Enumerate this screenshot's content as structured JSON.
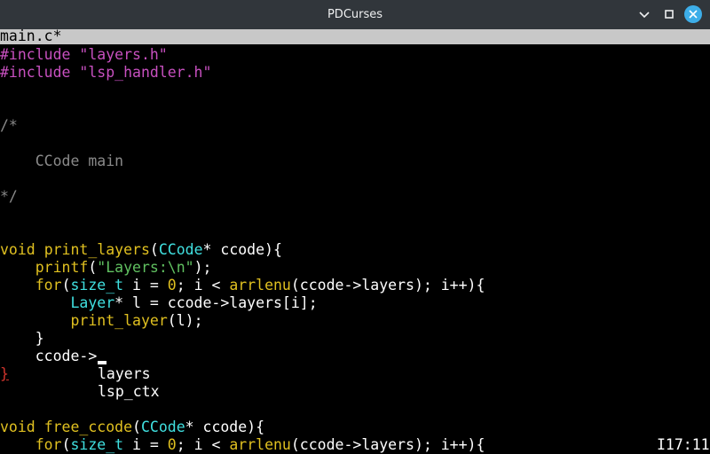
{
  "window": {
    "title": "PDCurses",
    "titlebar_color": "#31363b",
    "close_button_color": "#3daee9",
    "controls": [
      "chevron-down-icon",
      "maximize-icon",
      "close-icon"
    ]
  },
  "editor": {
    "filename": "main.c*",
    "status_bar_color": "#c8c8c8",
    "colors": {
      "preprocessor": "#c850c0",
      "keyword": "#e0c020",
      "type": "#40e0e0",
      "function": "#e0c020",
      "string": "#60c060",
      "comment": "#8a8a8a",
      "number": "#e0c020",
      "default": "#ffffff",
      "error": "#d0342c"
    },
    "lines": [
      {
        "segments": [
          {
            "t": "#include \"layers.h\"",
            "c": "preprocessor"
          }
        ]
      },
      {
        "segments": [
          {
            "t": "#include \"lsp_handler.h\"",
            "c": "preprocessor"
          }
        ]
      },
      {
        "segments": []
      },
      {
        "segments": []
      },
      {
        "segments": [
          {
            "t": "/*",
            "c": "comment"
          }
        ]
      },
      {
        "segments": []
      },
      {
        "segments": [
          {
            "t": "    CCode main",
            "c": "comment"
          }
        ]
      },
      {
        "segments": []
      },
      {
        "segments": [
          {
            "t": "*/",
            "c": "comment"
          }
        ]
      },
      {
        "segments": []
      },
      {
        "segments": []
      },
      {
        "segments": [
          {
            "t": "void",
            "c": "keyword"
          },
          {
            "t": " ",
            "c": "default"
          },
          {
            "t": "print_layers",
            "c": "function"
          },
          {
            "t": "(",
            "c": "default"
          },
          {
            "t": "CCode",
            "c": "type"
          },
          {
            "t": "* ccode){",
            "c": "default"
          }
        ]
      },
      {
        "segments": [
          {
            "t": "    ",
            "c": "default"
          },
          {
            "t": "printf",
            "c": "function"
          },
          {
            "t": "(",
            "c": "default"
          },
          {
            "t": "\"Layers:\\n\"",
            "c": "string"
          },
          {
            "t": ");",
            "c": "default"
          }
        ]
      },
      {
        "segments": [
          {
            "t": "    ",
            "c": "default"
          },
          {
            "t": "for",
            "c": "keyword"
          },
          {
            "t": "(",
            "c": "default"
          },
          {
            "t": "size_t",
            "c": "type"
          },
          {
            "t": " i = ",
            "c": "default"
          },
          {
            "t": "0",
            "c": "number"
          },
          {
            "t": "; i < ",
            "c": "default"
          },
          {
            "t": "arrlenu",
            "c": "function"
          },
          {
            "t": "(ccode->layers); i++){",
            "c": "default"
          }
        ]
      },
      {
        "segments": [
          {
            "t": "        ",
            "c": "default"
          },
          {
            "t": "Layer",
            "c": "type"
          },
          {
            "t": "* l = ccode->layers[i];",
            "c": "default"
          }
        ]
      },
      {
        "segments": [
          {
            "t": "        ",
            "c": "default"
          },
          {
            "t": "print_layer",
            "c": "function"
          },
          {
            "t": "(l);",
            "c": "default"
          }
        ]
      },
      {
        "segments": [
          {
            "t": "    }",
            "c": "default"
          }
        ]
      },
      {
        "segments": [
          {
            "t": "    ccode->",
            "c": "default"
          }
        ]
      },
      {
        "segments": []
      },
      {
        "segments": []
      },
      {
        "segments": []
      },
      {
        "segments": [
          {
            "t": "void",
            "c": "keyword"
          },
          {
            "t": " ",
            "c": "default"
          },
          {
            "t": "free_ccode",
            "c": "function"
          },
          {
            "t": "(",
            "c": "default"
          },
          {
            "t": "CCode",
            "c": "type"
          },
          {
            "t": "* ccode){",
            "c": "default"
          }
        ]
      },
      {
        "segments": [
          {
            "t": "    ",
            "c": "default"
          },
          {
            "t": "for",
            "c": "keyword"
          },
          {
            "t": "(",
            "c": "default"
          },
          {
            "t": "size_t",
            "c": "type"
          },
          {
            "t": " i = ",
            "c": "default"
          },
          {
            "t": "0",
            "c": "number"
          },
          {
            "t": "; i < ",
            "c": "default"
          },
          {
            "t": "arrlenu",
            "c": "function"
          },
          {
            "t": "(ccode->layers); i++){",
            "c": "default"
          }
        ]
      }
    ],
    "unmatched_brace": "}",
    "autocomplete": [
      "layers",
      "lsp_ctx"
    ],
    "cursor_position": "I17:11"
  }
}
